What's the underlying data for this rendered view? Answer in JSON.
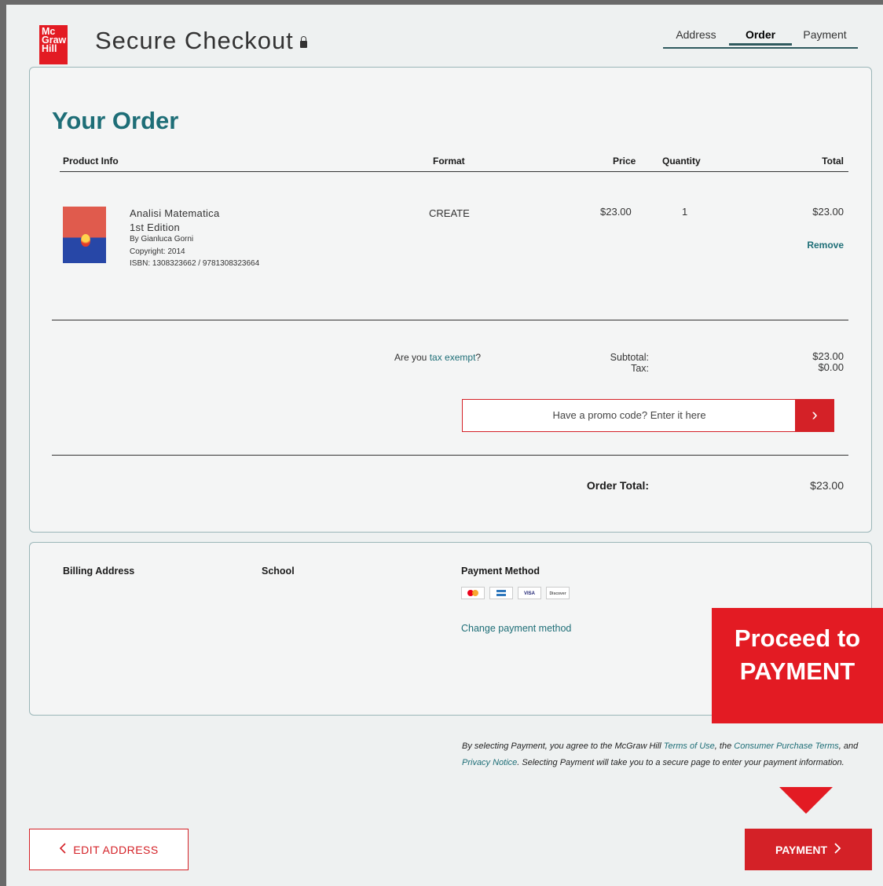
{
  "header": {
    "logo_lines": [
      "Mc",
      "Graw",
      "Hill"
    ],
    "title": "Secure Checkout",
    "steps": [
      {
        "label": "Address",
        "active": false
      },
      {
        "label": "Order",
        "active": true
      },
      {
        "label": "Payment",
        "active": false
      }
    ]
  },
  "order": {
    "heading": "Your Order",
    "columns": {
      "product": "Product Info",
      "format": "Format",
      "price": "Price",
      "quantity": "Quantity",
      "total": "Total"
    },
    "item": {
      "title": "Analisi Matematica",
      "edition": "1st Edition",
      "author": "By Gianluca Gorni",
      "copyright": "Copyright: 2014",
      "isbn": "ISBN: 1308323662 / 9781308323664",
      "format": "CREATE",
      "price": "$23.00",
      "quantity": "1",
      "total": "$23.00",
      "remove_label": "Remove"
    },
    "tax_prefix": "Are you ",
    "tax_link": "tax exempt",
    "tax_suffix": "?",
    "subtotal_label": "Subtotal:",
    "subtotal_value": "$23.00",
    "tax_label": "Tax:",
    "tax_value": "$0.00",
    "promo_placeholder": "Have a promo code? Enter it here",
    "promo_button": "›",
    "order_total_label": "Order Total:",
    "order_total_value": "$23.00"
  },
  "billing": {
    "billing_address_label": "Billing Address",
    "school_label": "School",
    "payment_method_label": "Payment Method",
    "card_brands": [
      "mastercard",
      "amex",
      "VISA",
      "Discover"
    ],
    "change_payment": "Change payment method"
  },
  "terms": {
    "t1": "By selecting Payment, you agree to the McGraw Hill ",
    "terms_of_use": "Terms of Use",
    "t2": ", the ",
    "consumer_terms": "Consumer Purchase Terms",
    "t3": ", and ",
    "privacy": "Privacy Notice",
    "t4": ". Selecting Payment will take you to a secure page to enter your payment information."
  },
  "actions": {
    "edit_address": "EDIT ADDRESS",
    "payment": "PAYMENT"
  },
  "callout": {
    "line1": "Proceed to",
    "line2": "PAYMENT"
  },
  "colors": {
    "brand_red": "#e31b23",
    "teal": "#1e6e77"
  }
}
